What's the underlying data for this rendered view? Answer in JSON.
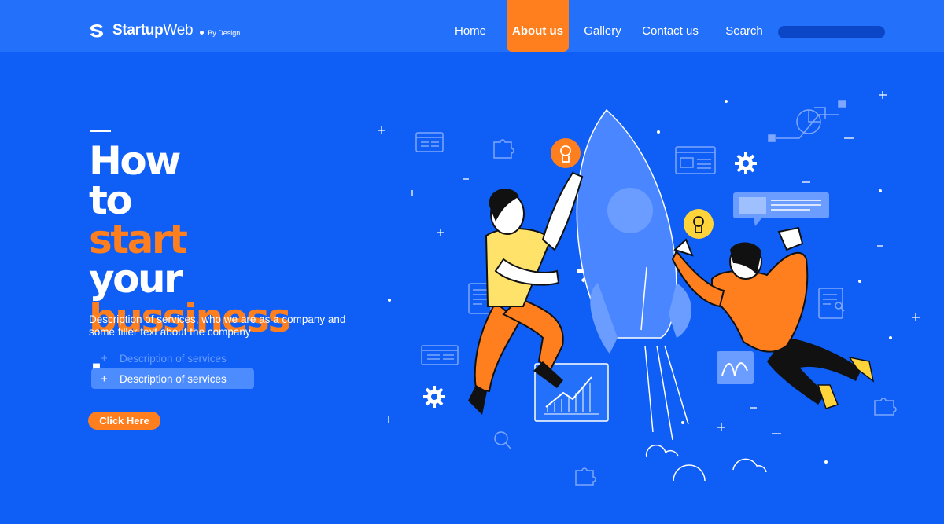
{
  "brand": {
    "name_bold": "Startup",
    "name_regular": "Web",
    "tagline": "By Design"
  },
  "nav": {
    "items": [
      {
        "label": "Home"
      },
      {
        "label": "About us",
        "active": true
      },
      {
        "label": "Gallery"
      },
      {
        "label": "Contact us"
      },
      {
        "label": "Search"
      }
    ],
    "search_value": ""
  },
  "hero": {
    "title_lines": [
      {
        "parts": [
          "How"
        ]
      },
      {
        "parts": [
          "to ",
          "start"
        ]
      },
      {
        "parts": [
          "your"
        ]
      },
      {
        "parts": [
          "bussiness",
          "."
        ]
      }
    ],
    "description": "Description of services, who we are as a company and some filler text about the company",
    "services": [
      {
        "icon": "+",
        "label": "Description of services"
      },
      {
        "icon": "+",
        "label": "Description of services"
      }
    ],
    "cta_label": "Click Here"
  },
  "colors": {
    "background": "#0f5ef5",
    "topbar": "#2370fb",
    "accent": "#ff7f1e",
    "yellow": "#ffd43b"
  }
}
